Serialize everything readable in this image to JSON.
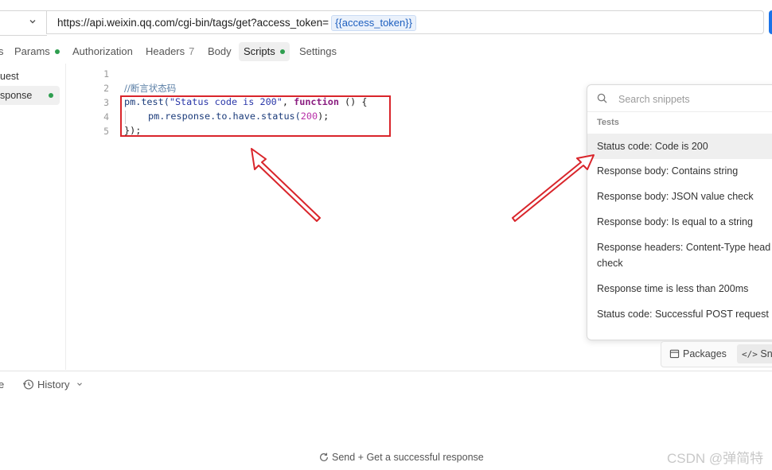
{
  "url_bar": {
    "url_text": "https://api.weixin.qq.com/cgi-bin/tags/get?access_token=",
    "variable": "{{access_token}}"
  },
  "tabs": [
    {
      "label": "s"
    },
    {
      "label": "Params",
      "dot": true
    },
    {
      "label": "Authorization"
    },
    {
      "label": "Headers",
      "count": "7"
    },
    {
      "label": "Body"
    },
    {
      "label": "Scripts",
      "dot": true,
      "active": true
    },
    {
      "label": "Settings"
    }
  ],
  "left_panel": {
    "items": [
      {
        "label": "uest"
      },
      {
        "label": "sponse",
        "active": true,
        "dot": true
      }
    ]
  },
  "editor": {
    "line_numbers": [
      "1",
      "2",
      "3",
      "4",
      "5"
    ],
    "comment": "//断言状态码",
    "line3": {
      "obj": "pm",
      "method": ".test(",
      "str": "\"Status code is 200\"",
      "sep": ", ",
      "kw": "function",
      "rest": " () {"
    },
    "line4": {
      "chain": "pm.response.to.have.status(",
      "num": "200",
      "end": ");"
    },
    "line5": "});"
  },
  "snippets": {
    "search_placeholder": "Search snippets",
    "heading": "Tests",
    "items": [
      "Status code: Code is 200",
      "Response body: Contains string",
      "Response body: JSON value check",
      "Response body: Is equal to a string",
      "Response headers: Content-Type head",
      "check",
      "Response time is less than 200ms",
      "Status code: Successful POST request"
    ]
  },
  "bottom_toolbar": {
    "packages_label": "Packages",
    "snippets_label": "Sni"
  },
  "response": {
    "left_tab": "e",
    "history_label": "History",
    "send_hint": "Send + Get a successful response"
  },
  "watermark": "CSDN @弹简特",
  "colors": {
    "accent": "#1a73e8",
    "status_dot": "#2e9e4f",
    "annotation_red": "#d9252b"
  }
}
